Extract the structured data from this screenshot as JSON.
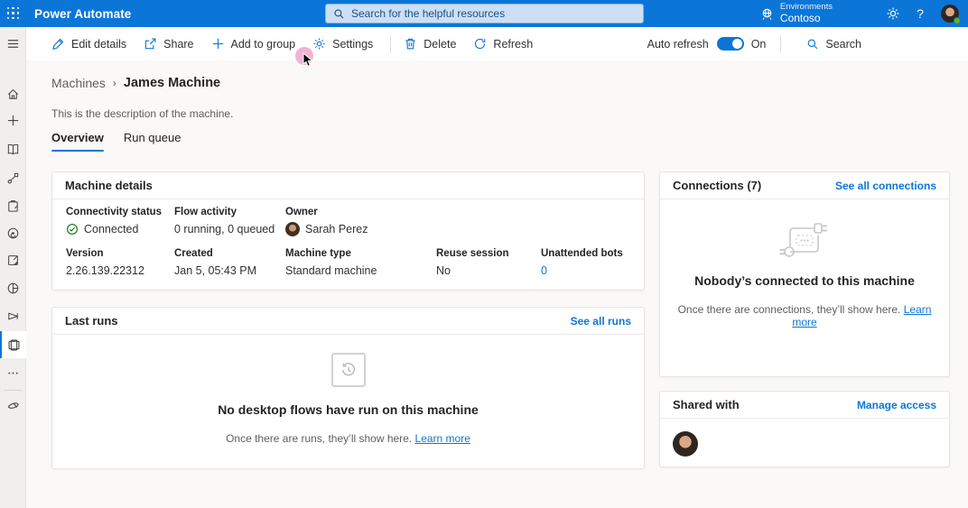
{
  "colors": {
    "topbar_blue": "#0b76d8",
    "accent_link": "#0b76d8",
    "connected_green": "#127c10",
    "presence_green": "#65b70b",
    "cursor_highlight_pink": "#f3aed2"
  },
  "topbar": {
    "app_title": "Power Automate",
    "search_placeholder": "Search for the helpful resources",
    "environments_label": "Environments",
    "environment_name": "Contoso",
    "help_label": "?"
  },
  "sidebar": {
    "items": [
      "hamburger-menu-icon",
      "home-icon",
      "create-icon",
      "learn-icon",
      "flows-icon",
      "templates-icon",
      "process-mining-icon",
      "activity-icon",
      "ai-builder-icon",
      "solutions-icon",
      "machines-icon",
      "more-icon",
      "power-platform-icon"
    ],
    "selected": "machines-icon"
  },
  "toolbar": {
    "buttons": [
      {
        "label": "Edit details",
        "icon": "pencil-icon"
      },
      {
        "label": "Share",
        "icon": "share-icon"
      },
      {
        "label": "Add to group",
        "icon": "plus-icon"
      },
      {
        "label": "Settings",
        "icon": "gear-icon"
      },
      {
        "label": "Delete",
        "icon": "trash-icon"
      },
      {
        "label": "Refresh",
        "icon": "refresh-icon"
      }
    ],
    "auto_refresh_label": "Auto refresh",
    "auto_refresh_state": "On",
    "search_label": "Search"
  },
  "page": {
    "breadcrumb": {
      "parent": "Machines",
      "separator": "›",
      "current": "James Machine"
    },
    "description": "This is the description of the machine.",
    "tabs": [
      {
        "label": "Overview"
      },
      {
        "label": "Run queue"
      }
    ]
  },
  "machine_details": {
    "title": "Machine details",
    "fields": [
      {
        "label": "Connectivity status",
        "value": "Connected"
      },
      {
        "label": "Flow activity",
        "value": "0 running, 0 queued"
      },
      {
        "label": "Owner",
        "value": "Sarah Perez"
      },
      {
        "label": "Version",
        "value": "2.26.139.22312"
      },
      {
        "label": "Created",
        "value": "Jan 5, 05:43 PM"
      },
      {
        "label": "Machine type",
        "value": "Standard machine"
      },
      {
        "label": "Reuse session",
        "value": "No"
      },
      {
        "label": "Unattended bots",
        "value": "0"
      }
    ]
  },
  "last_runs": {
    "title": "Last runs",
    "action": "See all runs",
    "empty_title": "No desktop flows have run on this machine",
    "empty_text": "Once there are runs, they’ll show here.",
    "learn_more": "Learn more"
  },
  "connections": {
    "title": "Connections (7)",
    "action": "See all connections",
    "empty_title": "Nobody’s connected to this machine",
    "empty_text": "Once there are connections, they’ll show here.",
    "learn_more": "Learn more"
  },
  "shared_with": {
    "title": "Shared with",
    "action": "Manage access"
  }
}
